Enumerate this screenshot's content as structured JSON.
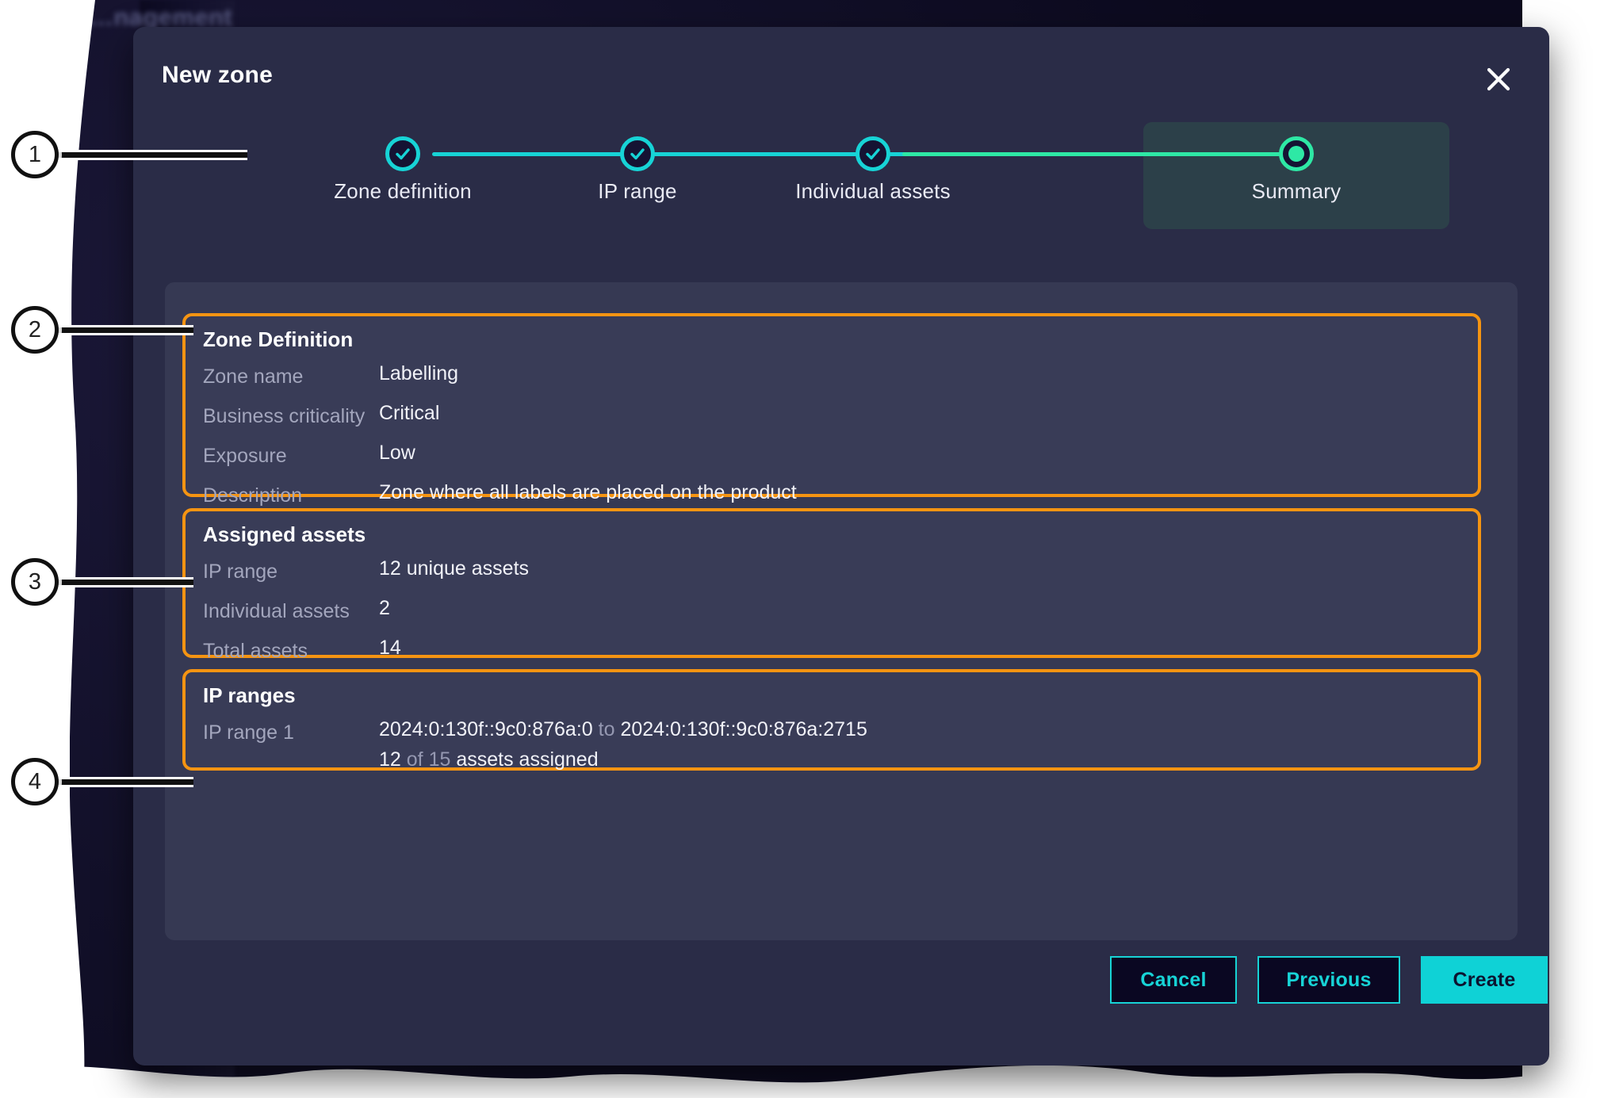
{
  "background": {
    "page_title_behind_modal": "…nagement"
  },
  "modal": {
    "title": "New zone",
    "close_icon": "close-icon"
  },
  "stepper": {
    "steps": [
      {
        "label": "Zone definition",
        "state": "completed",
        "icon": "check-icon"
      },
      {
        "label": "IP range",
        "state": "completed",
        "icon": "check-icon"
      },
      {
        "label": "Individual assets",
        "state": "completed",
        "icon": "check-icon"
      },
      {
        "label": "Summary",
        "state": "current",
        "icon": "dot-icon"
      }
    ],
    "completed_color": "#17d3d6",
    "current_color": "#2ee8a5",
    "current_panel_color": "#2c4049"
  },
  "sections": {
    "zone_definition": {
      "title": "Zone Definition",
      "rows": [
        {
          "label": "Zone name",
          "value": "Labelling"
        },
        {
          "label": "Business criticality",
          "value": "Critical"
        },
        {
          "label": "Exposure",
          "value": "Low"
        },
        {
          "label": "Description",
          "value": "Zone where all labels are placed on the product"
        }
      ]
    },
    "assigned_assets": {
      "title": "Assigned assets",
      "rows": [
        {
          "label": "IP range",
          "value": "12 unique assets"
        },
        {
          "label": "Individual assets",
          "value": "2"
        },
        {
          "label": "Total assets",
          "value": "14"
        }
      ]
    },
    "ip_ranges": {
      "title": "IP ranges",
      "row_label": "IP range 1",
      "range_from": "2024:0:130f::9c0:876a:0",
      "range_sep": "to",
      "range_to": "2024:0:130f::9c0:876a:2715",
      "assigned_count": "12",
      "assigned_of": "of",
      "assigned_total": "15",
      "assigned_suffix": "assets assigned"
    }
  },
  "footer": {
    "cancel_label": "Cancel",
    "previous_label": "Previous",
    "create_label": "Create"
  },
  "annotations": [
    {
      "number": "1"
    },
    {
      "number": "2"
    },
    {
      "number": "3"
    },
    {
      "number": "4"
    }
  ],
  "colors": {
    "modal_bg": "#2a2c47",
    "panel_bg": "#363953",
    "section_bg": "#393c57",
    "highlight_border": "#f59412",
    "accent_cyan": "#0fd2d6",
    "accent_green": "#2ee8a5",
    "label_text": "#a3a6bd",
    "value_text": "#f1f2f8"
  }
}
